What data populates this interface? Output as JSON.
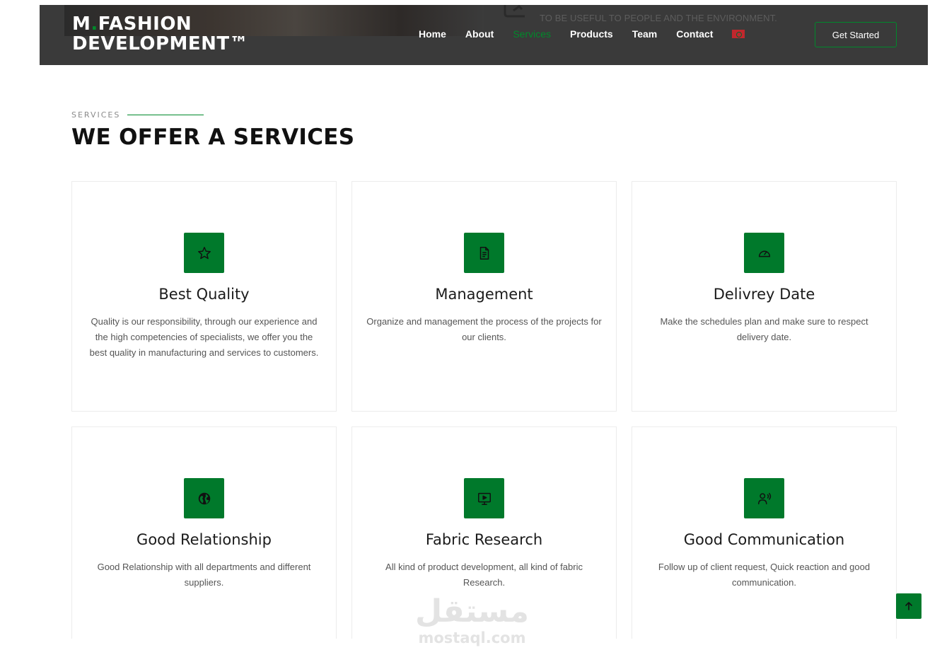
{
  "header": {
    "hero_tagline": "TO BE USEFUL TO PEOPLE AND THE ENVIRONMENT.",
    "logo_line1_a": "M",
    "logo_line1_dot": ".",
    "logo_line1_b": "FASHION",
    "logo_line2": "DEVELOPMENT™",
    "nav": [
      {
        "label": "Home"
      },
      {
        "label": "About"
      },
      {
        "label": "Services"
      },
      {
        "label": "Products"
      },
      {
        "label": "Team"
      },
      {
        "label": "Contact"
      }
    ],
    "language_flag_icon": "morocco-flag-icon",
    "cta_label": "Get Started"
  },
  "section": {
    "label": "SERVICES",
    "title": "WE OFFER A SERVICES"
  },
  "services": [
    {
      "icon": "star-icon",
      "title": "Best Quality",
      "text": "Quality is our responsibility, through our experience and the high competencies of specialists, we offer you the best quality in manufacturing and services to customers."
    },
    {
      "icon": "document-icon",
      "title": "Management",
      "text": "Organize and management the process of the projects for our clients."
    },
    {
      "icon": "speedometer-icon",
      "title": "Delivrey Date",
      "text": "Make the schedules plan and make sure to respect delivery date."
    },
    {
      "icon": "globe-icon",
      "title": "Good Relationship",
      "text": "Good Relationship with all departments and different suppliers."
    },
    {
      "icon": "presentation-play-icon",
      "title": "Fabric Research",
      "text": "All kind of product development, all kind of fabric Research."
    },
    {
      "icon": "person-voice-icon",
      "title": "Good Communication",
      "text": "Follow up of client request, Quick reaction and good communication."
    }
  ],
  "watermark": {
    "arabic": "مستقل",
    "latin": "mostaql.com"
  },
  "colors": {
    "accent": "#00892b",
    "icon_bg": "#00792b",
    "header_bg": "#3a3a3a"
  }
}
